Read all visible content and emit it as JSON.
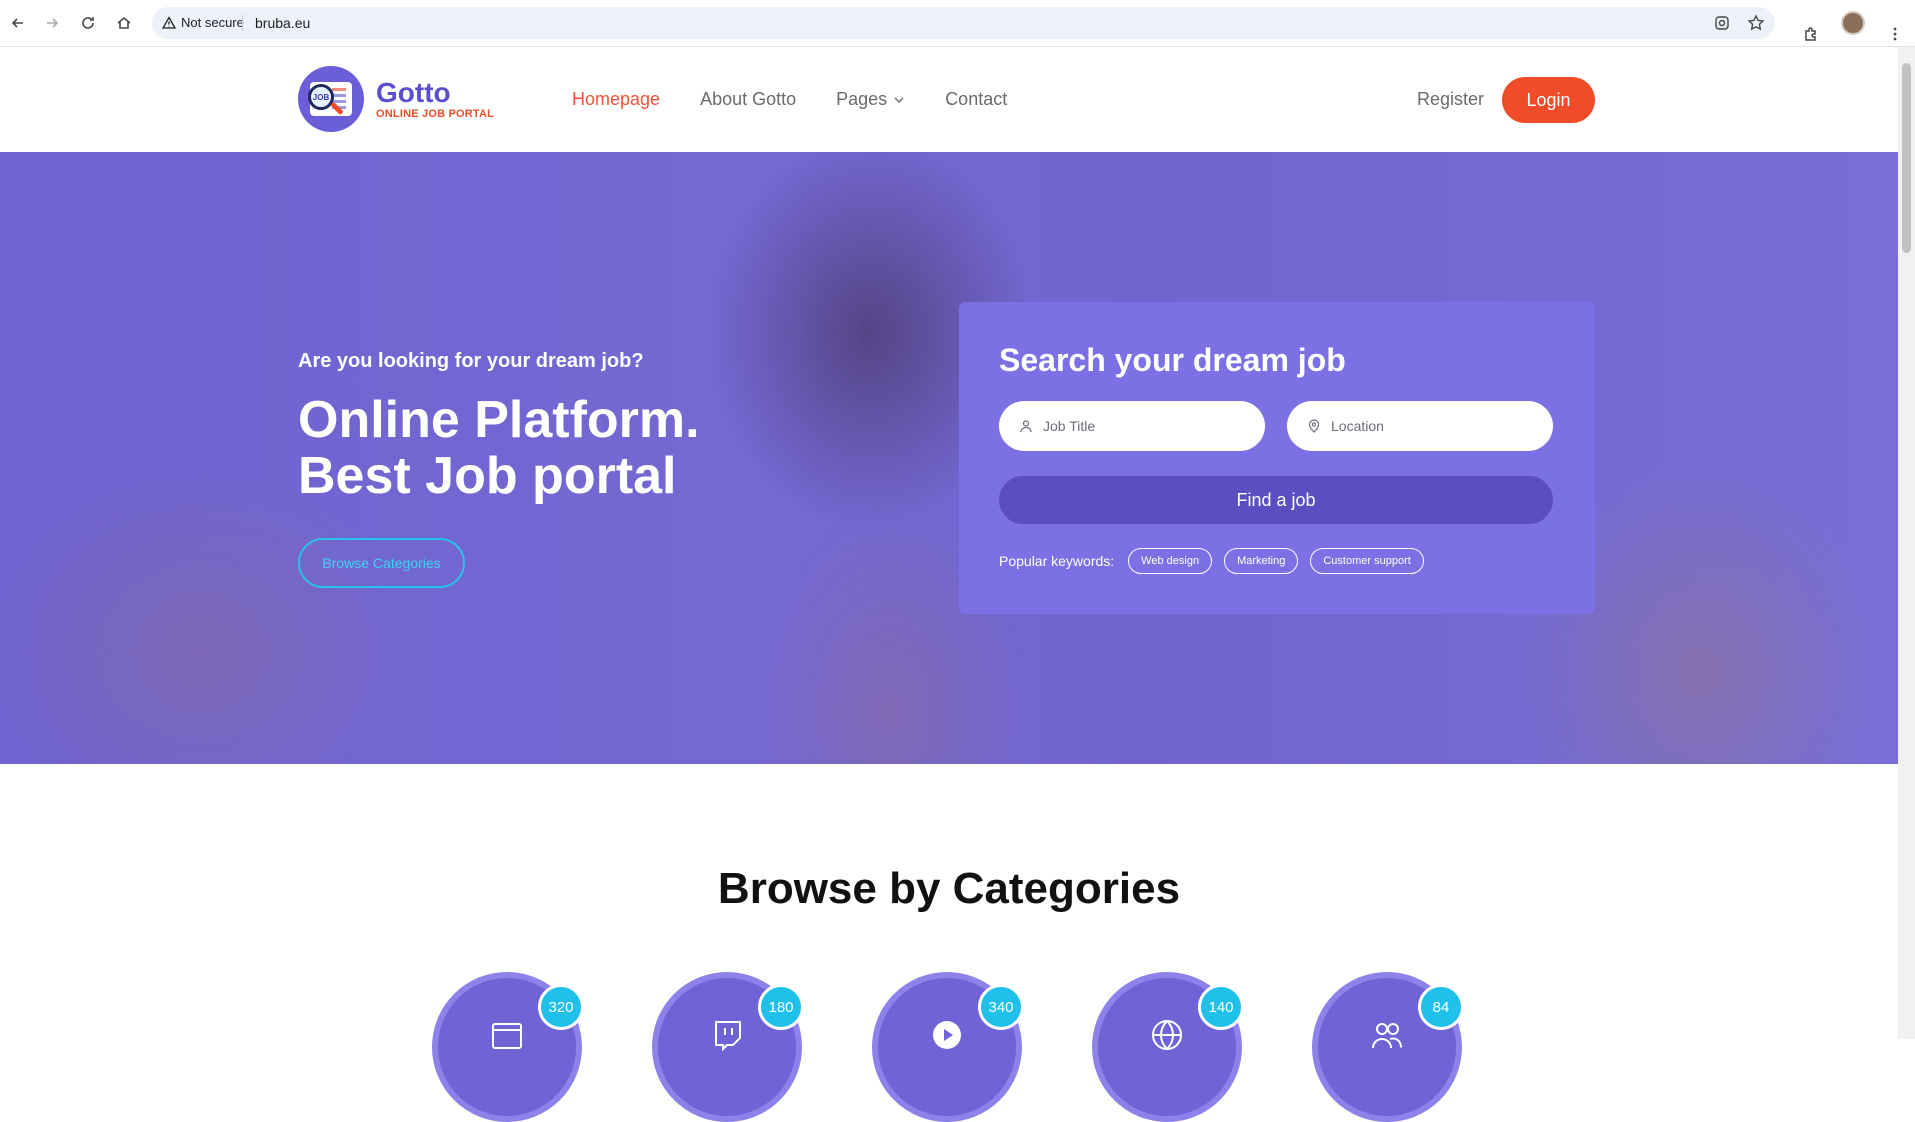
{
  "browser": {
    "security_label": "Not secure",
    "url": "bruba.eu"
  },
  "site": {
    "logo_name": "Gotto",
    "logo_tagline": "ONLINE JOB PORTAL",
    "logo_badge_text": "JOB",
    "nav": {
      "home": "Homepage",
      "about": "About Gotto",
      "pages": "Pages",
      "contact": "Contact"
    },
    "register": "Register",
    "login": "Login"
  },
  "hero": {
    "subtitle": "Are you looking for your dream job?",
    "title_line1": "Online Platform.",
    "title_line2": "Best Job portal",
    "browse_button": "Browse Categories"
  },
  "search": {
    "heading": "Search your dream job",
    "job_title_placeholder": "Job Title",
    "location_placeholder": "Location",
    "find_button": "Find a job",
    "popular_label": "Popular keywords:",
    "keywords": [
      "Web design",
      "Marketing",
      "Customer support"
    ]
  },
  "categories": {
    "title": "Browse by Categories",
    "items": [
      {
        "icon": "browser-window-icon",
        "count": "320"
      },
      {
        "icon": "twitch-icon",
        "count": "180"
      },
      {
        "icon": "play-icon",
        "count": "340"
      },
      {
        "icon": "globe-icon",
        "count": "140"
      },
      {
        "icon": "users-icon",
        "count": "84"
      }
    ]
  },
  "colors": {
    "brand_purple": "#5b4fd0",
    "accent_orange": "#f04c2a",
    "accent_cyan": "#1fc1ea",
    "search_card": "#7c70e5"
  }
}
